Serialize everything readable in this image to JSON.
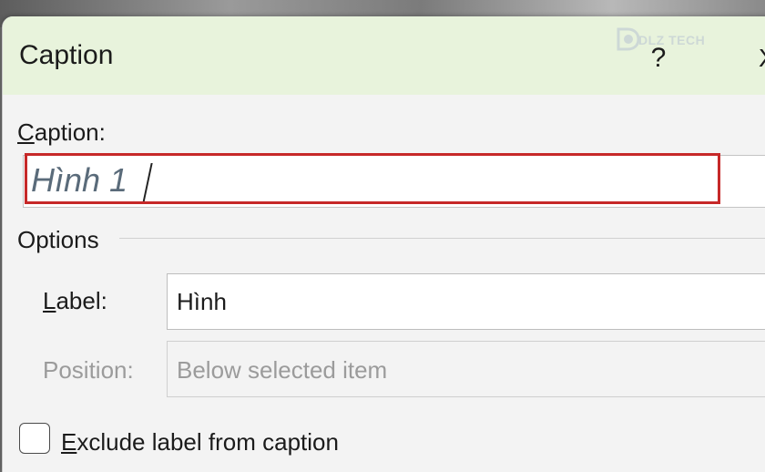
{
  "dialog": {
    "title": "Caption",
    "help_label": "?",
    "close_label": "X"
  },
  "watermark": {
    "text": "DLZ TECH"
  },
  "caption": {
    "label_prefix": "C",
    "label_rest": "aption:",
    "value": "Hình 1"
  },
  "options": {
    "heading": "Options",
    "label_field": {
      "label_prefix": "L",
      "label_rest": "abel:",
      "value": "Hình"
    },
    "position_field": {
      "label": "Position:",
      "value": "Below selected item"
    },
    "exclude_checkbox": {
      "label_prefix": "E",
      "label_rest": "xclude label from caption",
      "checked": false
    }
  },
  "colors": {
    "titlebar": "#e8f3dc",
    "highlight": "#c62828",
    "disabled_text": "#9b9b9b"
  }
}
